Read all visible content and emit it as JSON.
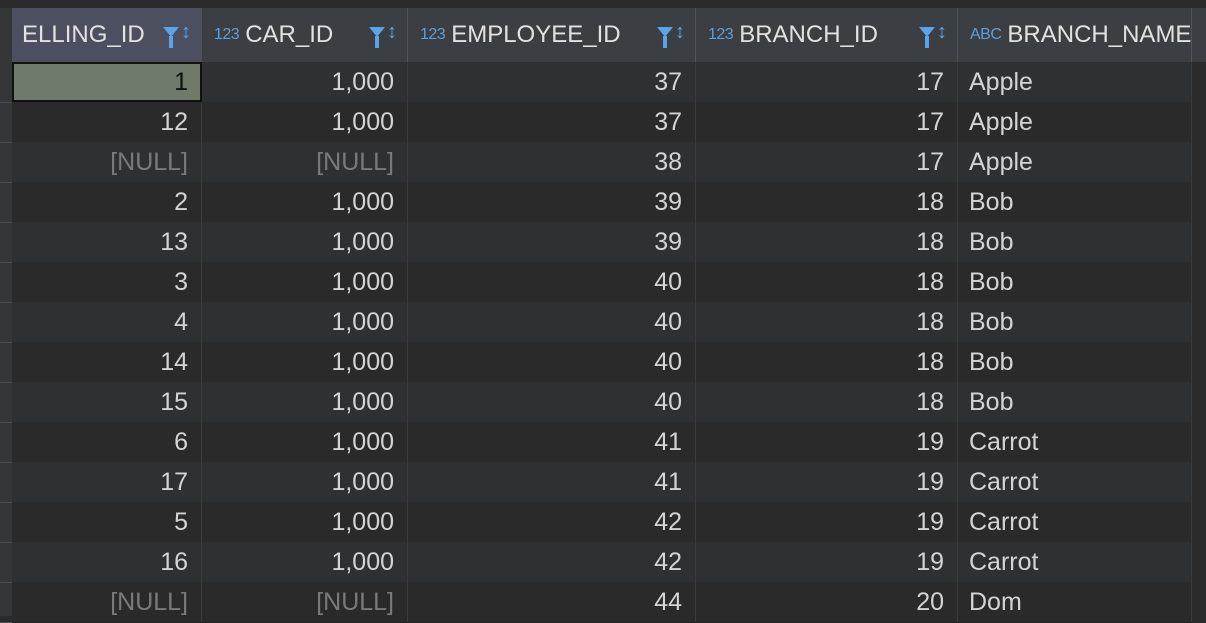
{
  "columns": [
    {
      "type": "",
      "name": "ELLING_ID",
      "key": false
    },
    {
      "type": "123",
      "name": "CAR_ID",
      "key": false
    },
    {
      "type": "123",
      "name": "EMPLOYEE_ID",
      "key": true
    },
    {
      "type": "123",
      "name": "BRANCH_ID",
      "key": true
    },
    {
      "type": "ABC",
      "name": "BRANCH_NAME",
      "key": true
    }
  ],
  "null_label": "[NULL]",
  "rows": [
    [
      "1",
      "1,000",
      "37",
      "17",
      "Apple"
    ],
    [
      "12",
      "1,000",
      "37",
      "17",
      "Apple"
    ],
    [
      "[NULL]",
      "[NULL]",
      "38",
      "17",
      "Apple"
    ],
    [
      "2",
      "1,000",
      "39",
      "18",
      "Bob"
    ],
    [
      "13",
      "1,000",
      "39",
      "18",
      "Bob"
    ],
    [
      "3",
      "1,000",
      "40",
      "18",
      "Bob"
    ],
    [
      "4",
      "1,000",
      "40",
      "18",
      "Bob"
    ],
    [
      "14",
      "1,000",
      "40",
      "18",
      "Bob"
    ],
    [
      "15",
      "1,000",
      "40",
      "18",
      "Bob"
    ],
    [
      "6",
      "1,000",
      "41",
      "19",
      "Carrot"
    ],
    [
      "17",
      "1,000",
      "41",
      "19",
      "Carrot"
    ],
    [
      "5",
      "1,000",
      "42",
      "19",
      "Carrot"
    ],
    [
      "16",
      "1,000",
      "42",
      "19",
      "Carrot"
    ],
    [
      "[NULL]",
      "[NULL]",
      "44",
      "20",
      "Dom"
    ]
  ],
  "selected_cell": {
    "row": 0,
    "col": 0
  },
  "icons": {
    "filter": "filter-icon",
    "sort": "sort-icon",
    "key": "key-icon"
  },
  "colors": {
    "background": "#2b2b2b",
    "header": "#3b3e42",
    "accent": "#5aa3e8",
    "selected": "#6f7a6b",
    "null_text": "#7a7a7a"
  }
}
